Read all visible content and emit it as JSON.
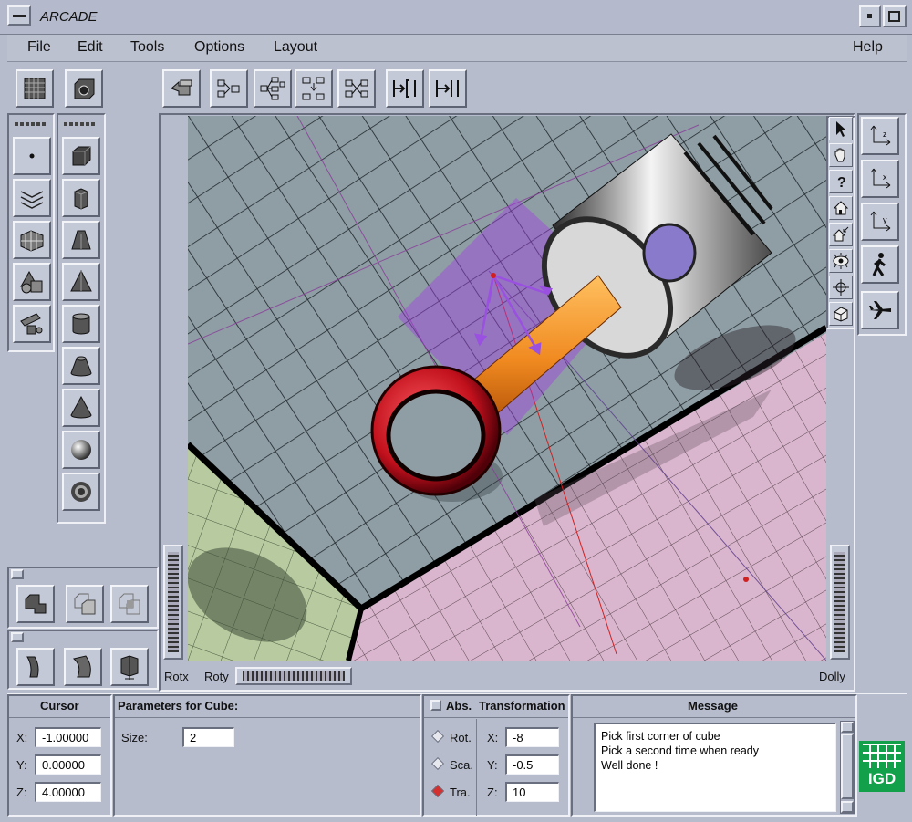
{
  "window": {
    "title": "ARCADE"
  },
  "menu": {
    "file": "File",
    "edit": "Edit",
    "tools": "Tools",
    "options": "Options",
    "layout": "Layout",
    "help": "Help"
  },
  "viewport": {
    "rotx_label": "Rotx",
    "roty_label": "Roty",
    "dolly_label": "Dolly"
  },
  "cursor": {
    "title": "Cursor",
    "x_label": "X:",
    "y_label": "Y:",
    "z_label": "Z:",
    "x": "-1.00000",
    "y": "0.00000",
    "z": "4.00000"
  },
  "params": {
    "title": "Parameters for Cube:",
    "size_label": "Size:",
    "size": "2"
  },
  "transform": {
    "abs_label": "Abs.",
    "title": "Transformation",
    "rot_label": "Rot.",
    "sca_label": "Sca.",
    "tra_label": "Tra.",
    "x_label": "X:",
    "y_label": "Y:",
    "z_label": "Z:",
    "x": "-8",
    "y": "-0.5",
    "z": "10",
    "selected_mode": "Tra."
  },
  "message": {
    "title": "Message",
    "lines": [
      "Pick first corner of cube",
      "Pick a second time when ready",
      "Well done !"
    ]
  },
  "logo": {
    "text": "IGD"
  },
  "colors": {
    "background": "#b6bccc",
    "title_bar": "#b6bccc",
    "logo_green": "#12a04a",
    "selection_purple": "#9a4fd0"
  }
}
